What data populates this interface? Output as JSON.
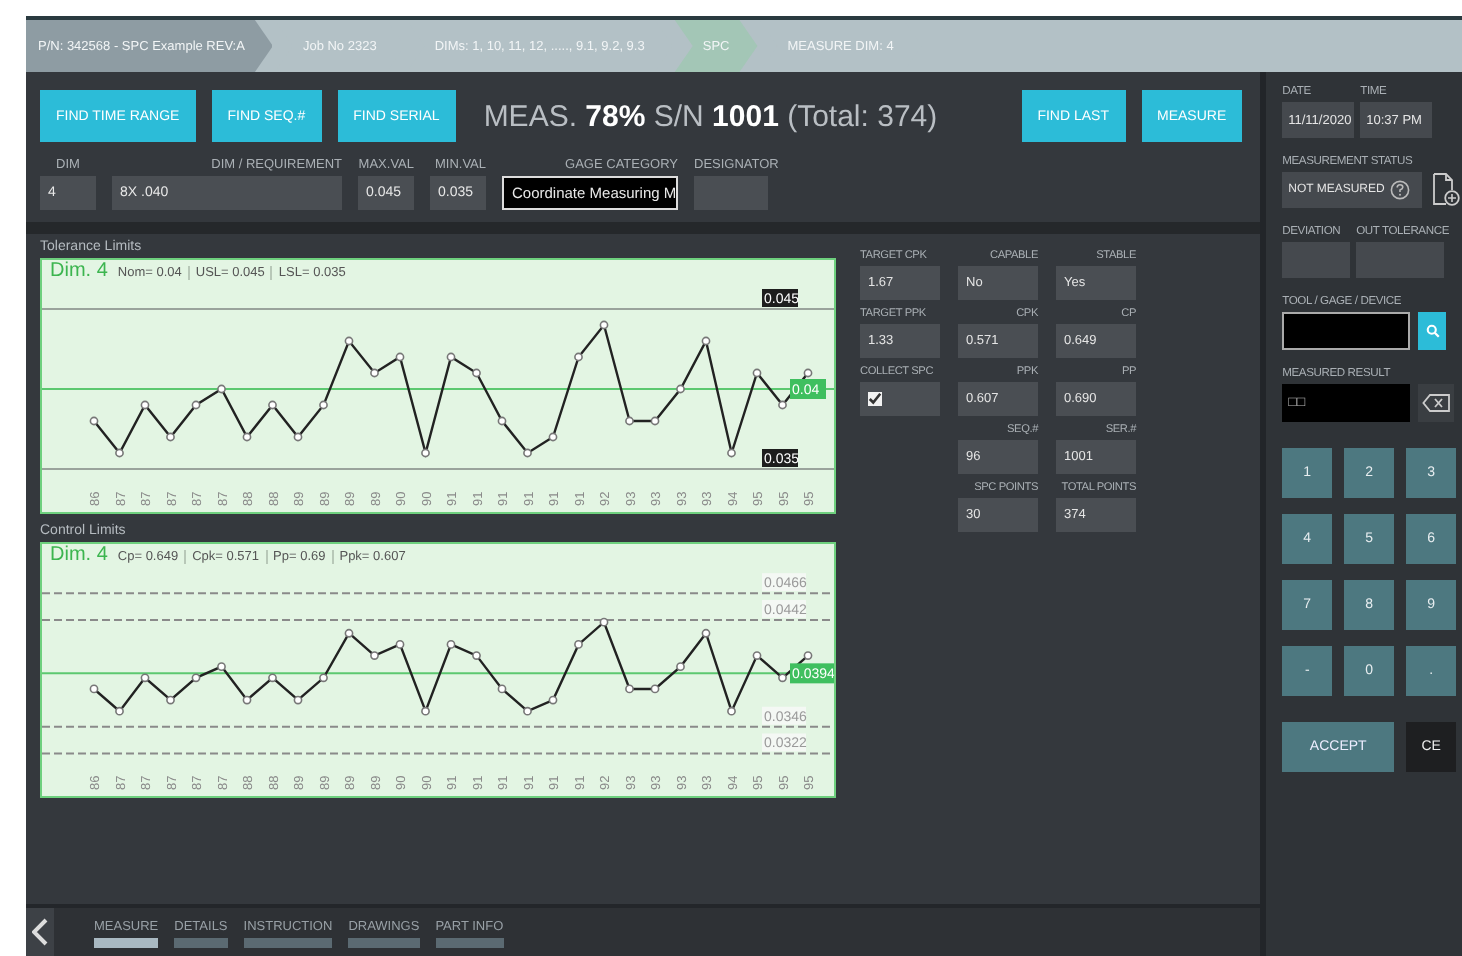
{
  "breadcrumb": [
    {
      "label": "P/N: 342568 - SPC Example REV:A",
      "color": "#8e9ca3"
    },
    {
      "label": "Job No 2323",
      "color": "#b3c1c6"
    },
    {
      "label": "DIMs: 1, 10, 11, 12, ....., 9.1, 9.2, 9.3",
      "color": "#b3c1c6"
    },
    {
      "label": "SPC",
      "color": "#a3c6b6"
    },
    {
      "label": "MEASURE DIM: 4",
      "color": "#b3c1c6"
    }
  ],
  "find_buttons": [
    "FIND TIME RANGE",
    "FIND SEQ.#",
    "FIND SERIAL"
  ],
  "headline": "MEAS. **78%** S/N **1001** (Total: 374)",
  "action_buttons": [
    "FIND LAST",
    "MEASURE"
  ],
  "fields": [
    {
      "label": "DIM",
      "value": "4",
      "kind": "plain"
    },
    {
      "label": "DIM / REQUIREMENT",
      "value": "8X .040",
      "kind": "plain"
    },
    {
      "label": "MAX.VAL",
      "value": "0.045",
      "kind": "plain"
    },
    {
      "label": "MIN.VAL",
      "value": "0.035",
      "kind": "plain"
    },
    {
      "label": "GAGE CATEGORY",
      "value": "Coordinate Measuring M",
      "kind": "focused"
    },
    {
      "label": "DESIGNATOR",
      "kind": "plain"
    }
  ],
  "charts": [
    {
      "title": "Tolerance Limits",
      "kind": "tolerance",
      "stats": [
        "Nom= 0.04",
        "USL= 0.045",
        "LSL= 0.035"
      ],
      "chart_data": {
        "type": "line",
        "categories": [
          "86",
          "87",
          "87",
          "87",
          "87",
          "87",
          "88",
          "88",
          "89",
          "89",
          "89",
          "89",
          "90",
          "90",
          "91",
          "91",
          "91",
          "91",
          "91",
          "91",
          "92",
          "93",
          "93",
          "93",
          "93",
          "94",
          "95",
          "95",
          "95"
        ],
        "series": [
          {
            "name": "Dim. 4",
            "color": "#222222",
            "marker": "circle",
            "values": [
              0.038,
              0.036,
              0.039,
              0.037,
              0.039,
              0.04,
              0.037,
              0.039,
              0.037,
              0.039,
              0.043,
              0.041,
              0.042,
              0.036,
              0.042,
              0.041,
              0.038,
              0.036,
              0.037,
              0.042,
              0.044,
              0.038,
              0.038,
              0.04,
              0.043,
              0.036,
              0.041,
              0.039,
              0.041
            ]
          }
        ],
        "ylim": [
          0.035,
          0.045
        ],
        "yticks": [
          {
            "value": 0.045,
            "label": "0.045"
          },
          {
            "value": 0.035,
            "label": "0.035"
          }
        ],
        "ref_lines": [
          {
            "axis": "y",
            "value": 0.04,
            "label": "0.04",
            "color": "#5cc870"
          }
        ]
      }
    },
    {
      "title": "Control Limits",
      "kind": "control",
      "stats": [
        "Cp= 0.649",
        "Cpk= 0.571",
        "Pp= 0.69",
        "Ppk= 0.607"
      ],
      "chart_data": {
        "type": "line",
        "categories": [
          "86",
          "87",
          "87",
          "87",
          "87",
          "87",
          "88",
          "88",
          "89",
          "89",
          "89",
          "89",
          "90",
          "90",
          "91",
          "91",
          "91",
          "91",
          "91",
          "91",
          "92",
          "93",
          "93",
          "93",
          "93",
          "94",
          "95",
          "95",
          "95"
        ],
        "series": [
          {
            "name": "Dim. 4",
            "color": "#222222",
            "marker": "circle",
            "values": [
              0.038,
              0.036,
              0.039,
              0.037,
              0.039,
              0.04,
              0.037,
              0.039,
              0.037,
              0.039,
              0.043,
              0.041,
              0.042,
              0.036,
              0.042,
              0.041,
              0.038,
              0.036,
              0.037,
              0.042,
              0.044,
              0.038,
              0.038,
              0.04,
              0.043,
              0.036,
              0.041,
              0.039,
              0.041
            ]
          }
        ],
        "ylim": [
          0.0282,
          0.0512
        ],
        "grid": true,
        "yticks": [
          {
            "value": 0.0466,
            "label": "0.0466"
          },
          {
            "value": 0.0442,
            "label": "0.0442"
          },
          {
            "value": 0.0346,
            "label": "0.0346"
          },
          {
            "value": 0.0322,
            "label": "0.0322"
          }
        ],
        "ref_lines": [
          {
            "axis": "y",
            "value": 0.0394,
            "label": "0.0394",
            "color": "#5cc870"
          }
        ]
      }
    }
  ],
  "stats": [
    [
      {
        "label": "TARGET CPK",
        "value": "1.67",
        "kind": "text"
      },
      {
        "label": "CAPABLE",
        "value": "No",
        "kind": "text"
      },
      {
        "label": "STABLE",
        "value": "Yes",
        "kind": "text"
      }
    ],
    [
      {
        "label": "TARGET PPK",
        "value": "1.33",
        "kind": "text"
      },
      {
        "label": "CPK",
        "value": "0.571",
        "kind": "text"
      },
      {
        "label": "CP",
        "value": "0.649",
        "kind": "text"
      }
    ],
    [
      {
        "label": "COLLECT SPC",
        "checked": true,
        "kind": "check"
      },
      {
        "label": "PPK",
        "value": "0.607",
        "kind": "text"
      },
      {
        "label": "PP",
        "value": "0.690",
        "kind": "text"
      }
    ],
    [
      {
        "label": "SEQ.#",
        "value": "96",
        "kind": "text"
      },
      {
        "label": "SER.#",
        "value": "1001",
        "kind": "text"
      }
    ],
    [
      {
        "label": "SPC POINTS",
        "value": "30",
        "kind": "text"
      },
      {
        "label": "TOTAL POINTS",
        "value": "374",
        "kind": "text"
      }
    ]
  ],
  "tabs": [
    {
      "label": "MEASURE",
      "selected": true
    },
    {
      "label": "DETAILS",
      "selected": false
    },
    {
      "label": "INSTRUCTION",
      "selected": false
    },
    {
      "label": "DRAWINGS",
      "selected": false
    },
    {
      "label": "PART INFO",
      "selected": false
    }
  ],
  "side": {
    "date_label": "DATE",
    "date": "11/11/2020",
    "time_label": "TIME",
    "time": "10:37 PM",
    "status_label": "MEASUREMENT STATUS",
    "status": "NOT MEASURED",
    "deviation_label": "DEVIATION",
    "out_tolerance_label": "OUT TOLERANCE",
    "tool_label": "TOOL / GAGE / DEVICE",
    "result_label": "MEASURED RESULT",
    "result": "□□",
    "keys": [
      "1",
      "2",
      "3",
      "4",
      "5",
      "6",
      "7",
      "8",
      "9",
      "-",
      "0",
      "."
    ],
    "accept": "ACCEPT",
    "clear": "CE"
  }
}
